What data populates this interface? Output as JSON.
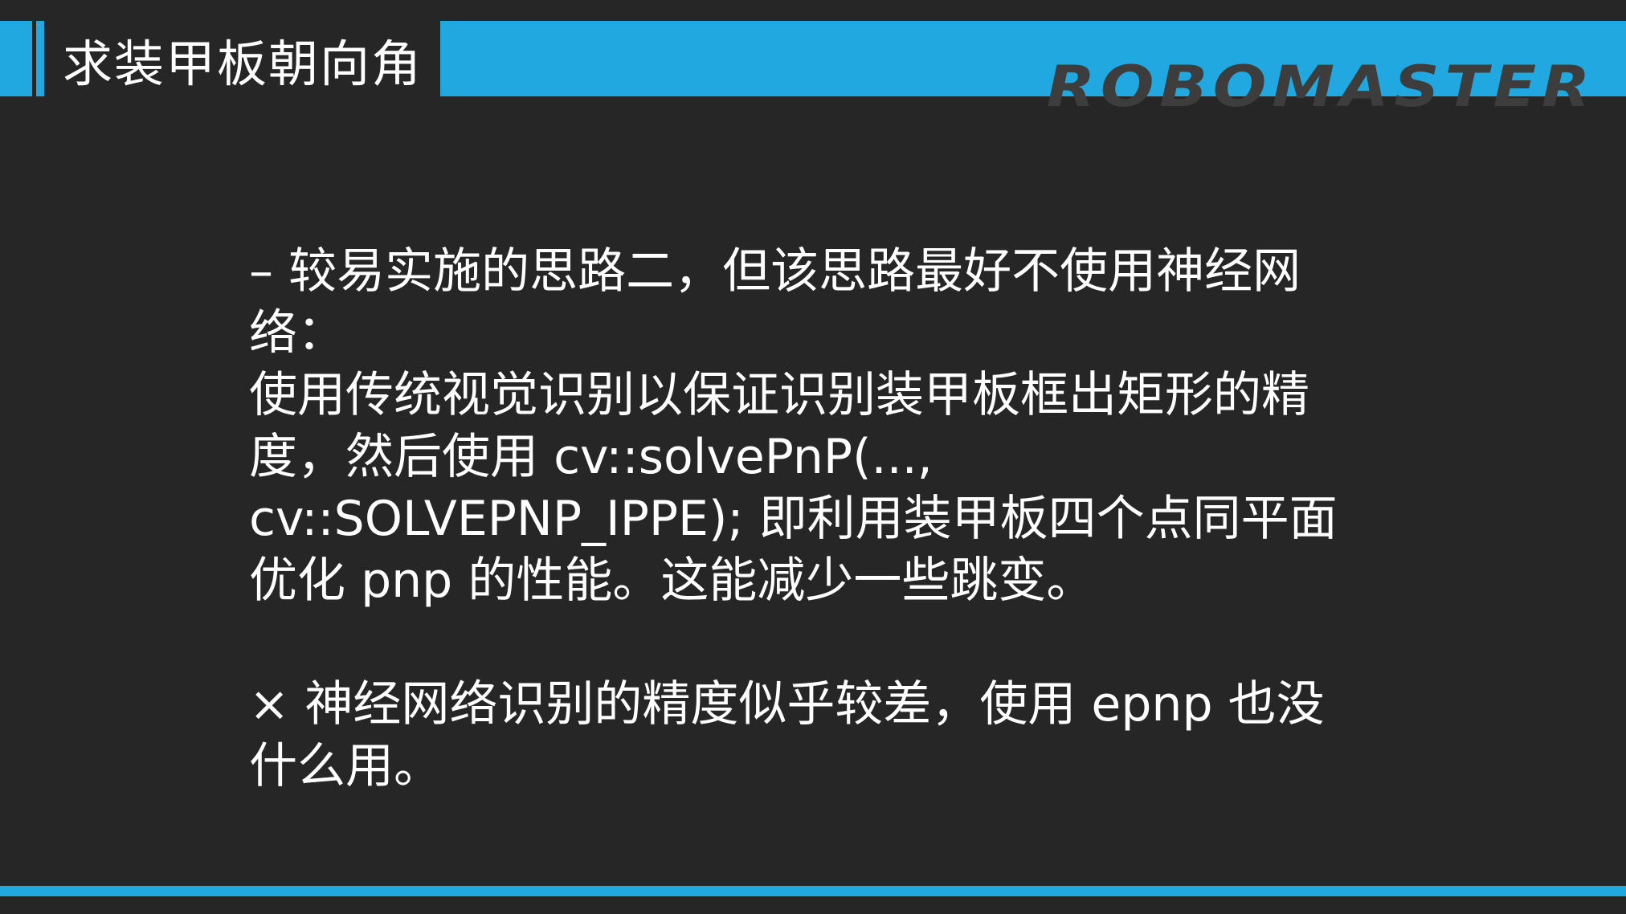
{
  "header": {
    "title": "求装甲板朝向角",
    "brand": "ROBOMASTER"
  },
  "content": {
    "paragraph1_lines": [
      "– 较易实施的思路二，但该思路最好不使用神经网",
      "络：",
      "使用传统视觉识别以保证识别装甲板框出矩形的精",
      "度，然后使用 cv::solvePnP(...,",
      "cv::SOLVEPNP_IPPE); 即利用装甲板四个点同平面",
      "优化 pnp 的性能。这能减少一些跳变。"
    ],
    "paragraph2_lines": [
      "× 神经网络识别的精度似乎较差，使用 epnp 也没",
      "什么用。"
    ]
  },
  "colors": {
    "background": "#262626",
    "accent": "#21a8e0",
    "brand_text": "#3d3d3d",
    "text": "#ffffff"
  }
}
